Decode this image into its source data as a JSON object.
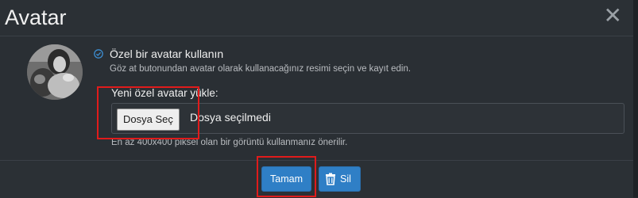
{
  "dialog": {
    "title": "Avatar",
    "close_label": "✕"
  },
  "custom_avatar": {
    "option_label": "Özel bir avatar kullanın",
    "description": "Göz at butonundan avatar olarak kullanacağınız resimi seçin ve kayıt edin."
  },
  "upload": {
    "label": "Yeni özel avatar yükle:",
    "button_label": "Dosya Seç",
    "status_text": "Dosya seçilmedi",
    "size_hint": "En az 400x400 piksel olan bir görüntü kullanmanız önerilir."
  },
  "footer": {
    "ok_label": "Tamam",
    "delete_label": "Sil"
  },
  "colors": {
    "primary": "#2f7fc6",
    "highlight": "#e01b1b",
    "background": "#2a2f34"
  },
  "icons": [
    "close-icon",
    "radio-check-icon",
    "trash-icon"
  ]
}
